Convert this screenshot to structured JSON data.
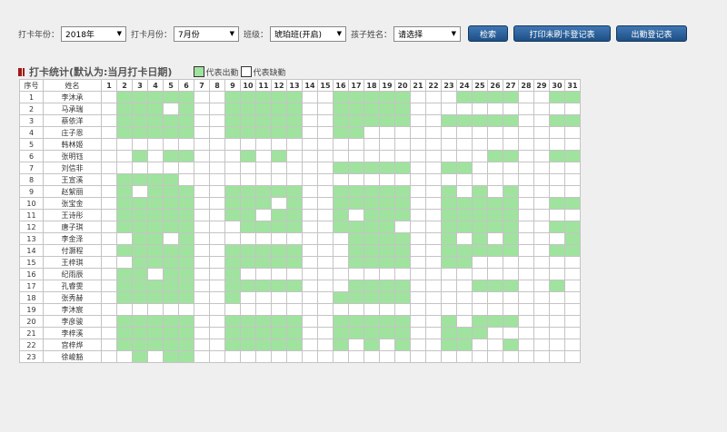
{
  "filters": {
    "year_label": "打卡年份：",
    "year_value": "2018年",
    "month_label": "打卡月份：",
    "month_value": "7月份",
    "class_label": "班级：",
    "class_value": "琥珀班(开启)",
    "child_label": "孩子姓名：",
    "child_value": "请选择"
  },
  "buttons": {
    "search": "检索",
    "print_unswiped": "打印未刷卡登记表",
    "attendance_register": "出勤登记表"
  },
  "section": {
    "title": "打卡统计(默认为:当月打卡日期)",
    "legend_present": "代表出勤",
    "legend_absent": "代表缺勤",
    "present_color": "#9fe39f",
    "absent_color": "#ffffff"
  },
  "table": {
    "header_index": "序号",
    "header_name": "姓名",
    "days": [
      "1",
      "2",
      "3",
      "4",
      "5",
      "6",
      "7",
      "8",
      "9",
      "10",
      "11",
      "12",
      "13",
      "14",
      "15",
      "16",
      "17",
      "18",
      "19",
      "20",
      "21",
      "22",
      "23",
      "24",
      "25",
      "26",
      "27",
      "28",
      "29",
      "30",
      "31"
    ],
    "rows": [
      {
        "index": "1",
        "name": "李沐承",
        "attendance": [
          0,
          1,
          1,
          1,
          1,
          1,
          0,
          0,
          1,
          1,
          1,
          1,
          1,
          0,
          0,
          1,
          1,
          1,
          1,
          1,
          0,
          0,
          0,
          1,
          1,
          1,
          1,
          0,
          0,
          1,
          1
        ]
      },
      {
        "index": "2",
        "name": "马承瑞",
        "attendance": [
          0,
          1,
          1,
          1,
          0,
          1,
          0,
          0,
          1,
          1,
          1,
          1,
          1,
          0,
          0,
          1,
          1,
          1,
          1,
          1,
          0,
          0,
          0,
          0,
          0,
          0,
          0,
          0,
          0,
          0,
          0
        ]
      },
      {
        "index": "3",
        "name": "蔡依洋",
        "attendance": [
          0,
          1,
          1,
          1,
          1,
          1,
          0,
          0,
          1,
          1,
          1,
          1,
          1,
          0,
          0,
          1,
          1,
          1,
          1,
          1,
          0,
          0,
          1,
          1,
          1,
          1,
          1,
          0,
          0,
          1,
          1
        ]
      },
      {
        "index": "4",
        "name": "庄子恩",
        "attendance": [
          0,
          1,
          1,
          1,
          1,
          1,
          0,
          0,
          1,
          1,
          1,
          1,
          1,
          0,
          0,
          1,
          1,
          0,
          0,
          0,
          0,
          0,
          0,
          0,
          0,
          0,
          0,
          0,
          0,
          0,
          0
        ]
      },
      {
        "index": "5",
        "name": "韩林姬",
        "attendance": [
          0,
          0,
          0,
          0,
          0,
          0,
          0,
          0,
          0,
          0,
          0,
          0,
          0,
          0,
          0,
          0,
          0,
          0,
          0,
          0,
          0,
          0,
          0,
          0,
          0,
          0,
          0,
          0,
          0,
          0,
          0
        ]
      },
      {
        "index": "6",
        "name": "张明钰",
        "attendance": [
          0,
          0,
          1,
          0,
          1,
          1,
          0,
          0,
          0,
          1,
          0,
          1,
          0,
          0,
          0,
          0,
          0,
          0,
          0,
          0,
          0,
          0,
          0,
          0,
          0,
          1,
          1,
          0,
          0,
          1,
          1
        ]
      },
      {
        "index": "7",
        "name": "刘信非",
        "attendance": [
          0,
          0,
          0,
          0,
          0,
          0,
          0,
          0,
          0,
          0,
          0,
          0,
          0,
          0,
          0,
          1,
          1,
          1,
          1,
          1,
          0,
          0,
          1,
          1,
          0,
          0,
          0,
          0,
          0,
          0,
          0
        ]
      },
      {
        "index": "8",
        "name": "王宣溪",
        "attendance": [
          0,
          1,
          1,
          1,
          1,
          0,
          0,
          0,
          0,
          0,
          0,
          0,
          0,
          0,
          0,
          0,
          0,
          0,
          0,
          0,
          0,
          0,
          0,
          0,
          0,
          0,
          0,
          0,
          0,
          0,
          0
        ]
      },
      {
        "index": "9",
        "name": "赵絮丽",
        "attendance": [
          0,
          1,
          0,
          1,
          1,
          1,
          0,
          0,
          1,
          1,
          1,
          1,
          1,
          0,
          0,
          1,
          1,
          1,
          1,
          1,
          0,
          0,
          1,
          0,
          1,
          0,
          1,
          0,
          0,
          0,
          0
        ]
      },
      {
        "index": "10",
        "name": "张宝金",
        "attendance": [
          0,
          1,
          1,
          1,
          1,
          1,
          0,
          0,
          1,
          1,
          1,
          0,
          1,
          0,
          0,
          1,
          1,
          1,
          1,
          1,
          0,
          0,
          1,
          1,
          1,
          1,
          1,
          0,
          0,
          1,
          1
        ]
      },
      {
        "index": "11",
        "name": "王诗彤",
        "attendance": [
          0,
          1,
          1,
          1,
          1,
          1,
          0,
          0,
          1,
          1,
          0,
          1,
          1,
          0,
          0,
          1,
          0,
          1,
          1,
          1,
          0,
          0,
          1,
          1,
          1,
          1,
          1,
          0,
          0,
          0,
          0
        ]
      },
      {
        "index": "12",
        "name": "唐子琪",
        "attendance": [
          0,
          1,
          1,
          1,
          1,
          1,
          0,
          0,
          0,
          1,
          1,
          1,
          1,
          0,
          0,
          1,
          1,
          1,
          1,
          0,
          0,
          0,
          1,
          1,
          1,
          1,
          1,
          0,
          0,
          1,
          1
        ]
      },
      {
        "index": "13",
        "name": "李金泽",
        "attendance": [
          0,
          0,
          1,
          1,
          0,
          1,
          0,
          0,
          0,
          0,
          0,
          0,
          0,
          0,
          0,
          0,
          1,
          1,
          1,
          1,
          0,
          0,
          1,
          0,
          1,
          0,
          1,
          0,
          0,
          0,
          1
        ]
      },
      {
        "index": "14",
        "name": "付灏程",
        "attendance": [
          0,
          1,
          1,
          1,
          1,
          1,
          0,
          0,
          1,
          1,
          1,
          1,
          1,
          0,
          0,
          0,
          1,
          1,
          1,
          1,
          0,
          0,
          1,
          1,
          1,
          1,
          1,
          0,
          0,
          1,
          1
        ]
      },
      {
        "index": "15",
        "name": "王梓琪",
        "attendance": [
          0,
          0,
          1,
          1,
          1,
          1,
          0,
          0,
          1,
          1,
          1,
          1,
          1,
          0,
          0,
          0,
          1,
          1,
          1,
          1,
          0,
          0,
          1,
          1,
          0,
          0,
          0,
          0,
          0,
          0,
          0
        ]
      },
      {
        "index": "16",
        "name": "纪雨辰",
        "attendance": [
          0,
          1,
          1,
          0,
          1,
          1,
          0,
          0,
          1,
          0,
          0,
          0,
          0,
          0,
          0,
          0,
          0,
          0,
          0,
          0,
          0,
          0,
          0,
          0,
          0,
          0,
          0,
          0,
          0,
          0,
          0
        ]
      },
      {
        "index": "17",
        "name": "孔睿雯",
        "attendance": [
          0,
          1,
          1,
          1,
          1,
          1,
          0,
          0,
          1,
          1,
          1,
          1,
          1,
          0,
          0,
          0,
          1,
          1,
          1,
          1,
          0,
          0,
          0,
          0,
          1,
          1,
          1,
          0,
          0,
          1,
          0
        ]
      },
      {
        "index": "18",
        "name": "张秀赫",
        "attendance": [
          0,
          1,
          1,
          1,
          1,
          1,
          0,
          0,
          1,
          0,
          0,
          0,
          0,
          0,
          0,
          1,
          1,
          1,
          1,
          1,
          0,
          0,
          0,
          0,
          0,
          0,
          0,
          0,
          0,
          0,
          0
        ]
      },
      {
        "index": "19",
        "name": "李沐宸",
        "attendance": [
          0,
          0,
          0,
          0,
          0,
          0,
          0,
          0,
          0,
          0,
          0,
          0,
          0,
          0,
          0,
          0,
          0,
          0,
          0,
          0,
          0,
          0,
          0,
          0,
          0,
          0,
          0,
          0,
          0,
          0,
          0
        ]
      },
      {
        "index": "20",
        "name": "李彦骏",
        "attendance": [
          0,
          1,
          1,
          1,
          1,
          1,
          0,
          0,
          1,
          1,
          1,
          1,
          1,
          0,
          0,
          1,
          1,
          1,
          1,
          1,
          0,
          0,
          1,
          0,
          1,
          1,
          1,
          0,
          0,
          0,
          0
        ]
      },
      {
        "index": "21",
        "name": "李梓溪",
        "attendance": [
          0,
          1,
          1,
          1,
          1,
          1,
          0,
          0,
          1,
          1,
          1,
          1,
          1,
          0,
          0,
          1,
          1,
          1,
          1,
          1,
          0,
          0,
          1,
          1,
          1,
          0,
          0,
          0,
          0,
          0,
          0
        ]
      },
      {
        "index": "22",
        "name": "宫梓烨",
        "attendance": [
          0,
          1,
          1,
          1,
          1,
          1,
          0,
          0,
          1,
          1,
          1,
          1,
          1,
          0,
          0,
          1,
          0,
          1,
          0,
          1,
          0,
          0,
          1,
          1,
          0,
          0,
          1,
          0,
          0,
          0,
          0
        ]
      },
      {
        "index": "23",
        "name": "徐峻豁",
        "attendance": [
          0,
          0,
          1,
          0,
          1,
          1,
          0,
          0,
          0,
          0,
          0,
          0,
          0,
          0,
          0,
          0,
          0,
          0,
          0,
          0,
          0,
          0,
          0,
          0,
          0,
          0,
          0,
          0,
          0,
          0,
          0
        ]
      }
    ]
  }
}
